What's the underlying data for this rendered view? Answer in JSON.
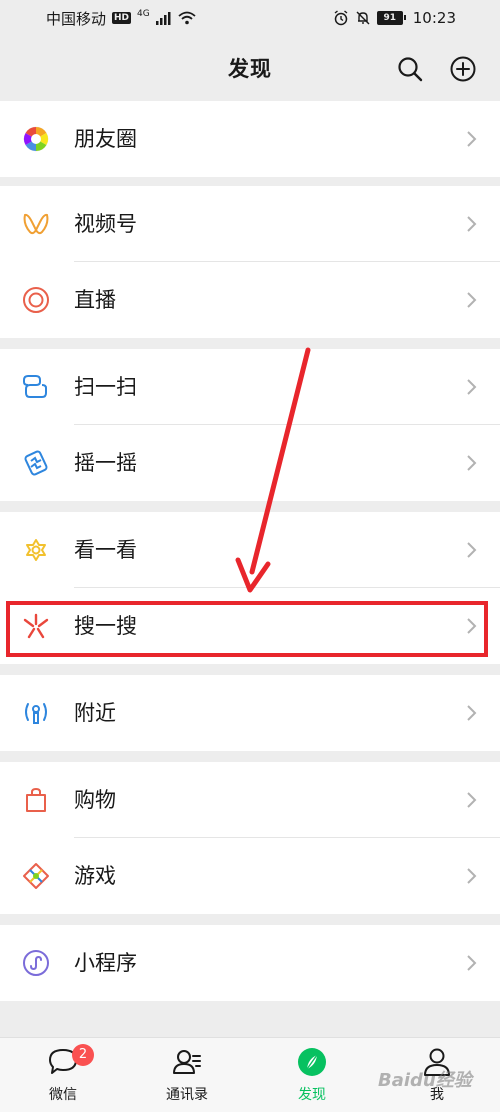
{
  "status_bar": {
    "carrier": "中国移动",
    "hd": "HD",
    "network": "4G",
    "battery": "91",
    "time": "10:23"
  },
  "header": {
    "title": "发现"
  },
  "menu": {
    "moments": "朋友圈",
    "channels": "视频号",
    "live": "直播",
    "scan": "扫一扫",
    "shake": "摇一摇",
    "top_stories": "看一看",
    "search": "搜一搜",
    "nearby": "附近",
    "shopping": "购物",
    "games": "游戏",
    "mini_programs": "小程序"
  },
  "tabbar": {
    "chats": "微信",
    "chats_badge": "2",
    "contacts": "通讯录",
    "discover": "发现",
    "me": "我"
  },
  "watermark": "Baidu经验",
  "colors": {
    "accent": "#07c160",
    "annotation": "#e8262c",
    "badge": "#fa5151"
  }
}
